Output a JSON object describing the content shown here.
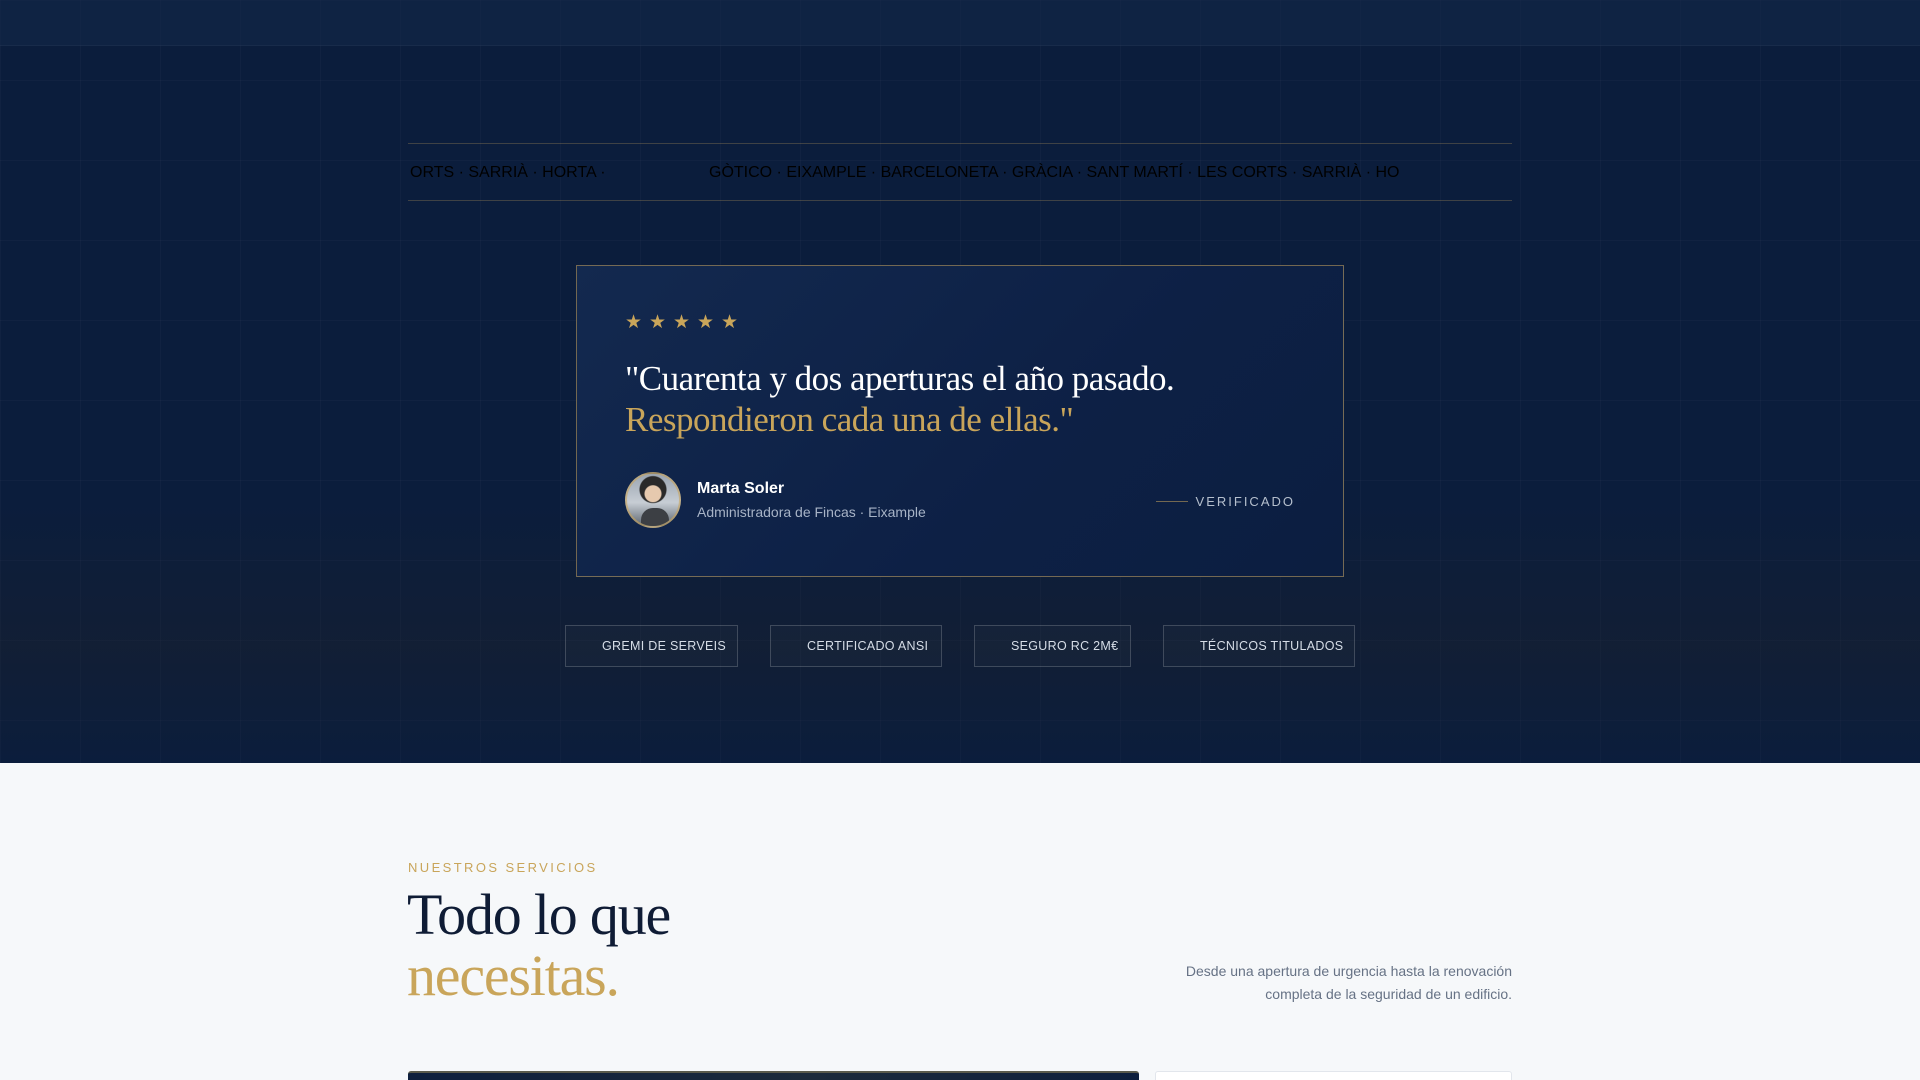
{
  "marquee": {
    "segments": [
      "ORTS · SARRIÀ · HORTA ·",
      "GÒTICO · EIXAMPLE · BARCELONETA · GRÀCIA · SANT MARTÍ · LES CORTS · SARRIÀ · HO"
    ]
  },
  "testimonial": {
    "rating": 5,
    "quote_line1": "\"Cuarenta y dos aperturas el año pasado.",
    "quote_line2": "Respondieron cada una de ellas.\"",
    "author_name": "Marta Soler",
    "author_role": "Administradora de Fincas · Eixample",
    "verified_label": "VERIFICADO"
  },
  "badges": [
    "GREMI DE SERVEIS",
    "CERTIFICADO ANSI",
    "SEGURO RC 2M€",
    "TÉCNICOS TITULADOS"
  ],
  "services": {
    "eyebrow": "NUESTROS SERVICIOS",
    "title_line1": "Todo lo que",
    "title_line2": "necesitas.",
    "description": "Desde una apertura de urgencia hasta la renovación completa de la seguridad de un edificio."
  },
  "colors": {
    "navy": "#0b1d3c",
    "gold": "#c9a55a",
    "text_dark": "#0f1c35",
    "page_bg": "#f6f8fa"
  }
}
